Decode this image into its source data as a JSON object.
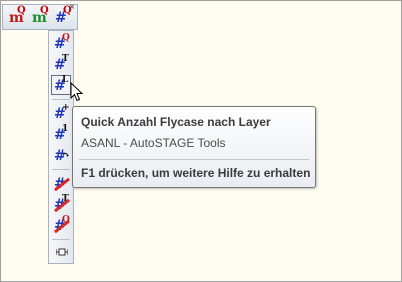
{
  "top_toolbar": {
    "buttons": [
      {
        "main": "m",
        "sup": "Q"
      },
      {
        "main": "m",
        "sup": "Q"
      },
      {
        "main": "#",
        "sup": "Q"
      }
    ],
    "close_glyph": "×"
  },
  "vertical_toolbar": {
    "buttons": [
      {
        "main": "#",
        "sup": "Q"
      },
      {
        "main": "#",
        "sup": "T"
      },
      {
        "main": "#",
        "sup": "L"
      },
      {
        "main": "#",
        "sup": "+"
      },
      {
        "main": "#",
        "sup": "1"
      },
      {
        "main": "#",
        "sup": "↷"
      },
      {
        "main": "#",
        "sup": ""
      },
      {
        "main": "#",
        "sup": "T"
      },
      {
        "main": "#",
        "sup": "Q"
      }
    ]
  },
  "tooltip": {
    "title": "Quick Anzahl Flycase nach Layer",
    "subtitle": "ASANL - AutoSTAGE Tools",
    "help": "F1 drücken, um weitere Hilfe zu erhalten"
  },
  "icons": [
    "close-icon",
    "pin-icon",
    "cursor-icon"
  ],
  "colors": {
    "background": "#fffdf1",
    "hash_blue": "#2036b8",
    "m_red": "#c41a1a",
    "m_green": "#1d8f2a",
    "strike_red": "#d42a2a"
  }
}
